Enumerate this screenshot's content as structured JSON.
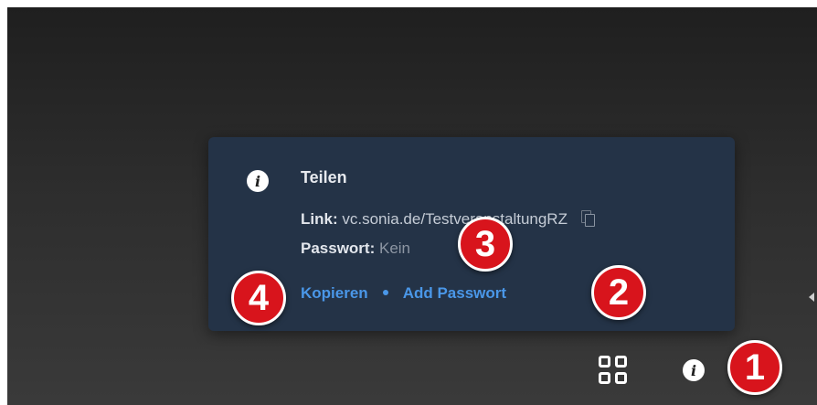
{
  "popup": {
    "title": "Teilen",
    "link_label": "Link:",
    "link_value": "vc.sonia.de/TestveranstaltungRZ",
    "password_label": "Passwort:",
    "password_value": "Kein",
    "copy_action": "Kopieren",
    "add_password_action": "Add Passwort"
  },
  "badges": [
    "1",
    "2",
    "3",
    "4"
  ],
  "icons": {
    "popup_icon": "info-icon",
    "copy_icon": "copy-icon",
    "toolbar_grid": "grid-view-icon",
    "toolbar_info": "info-icon"
  },
  "colors": {
    "popup_bg": "#243347",
    "action_link": "#4a97e8",
    "badge": "#d8141c"
  }
}
